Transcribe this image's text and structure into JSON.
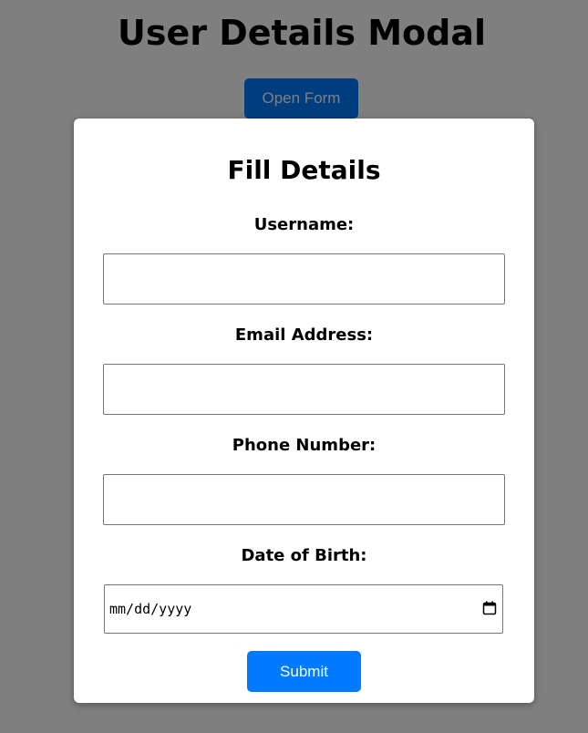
{
  "page": {
    "title": "User Details Modal",
    "open_button_label": "Open Form"
  },
  "modal": {
    "title": "Fill Details",
    "fields": [
      {
        "label": "Username:",
        "value": "",
        "type": "text"
      },
      {
        "label": "Email Address:",
        "value": "",
        "type": "email"
      },
      {
        "label": "Phone Number:",
        "value": "",
        "type": "tel"
      },
      {
        "label": "Date of Birth:",
        "value": "mm/dd/yyyy",
        "type": "date"
      }
    ],
    "submit_label": "Submit"
  },
  "icons": {
    "date_picker": "calendar-icon"
  },
  "colors": {
    "accent": "#007bff",
    "overlay": "rgba(0,0,0,0.5)",
    "modal_bg": "#ffffff"
  }
}
